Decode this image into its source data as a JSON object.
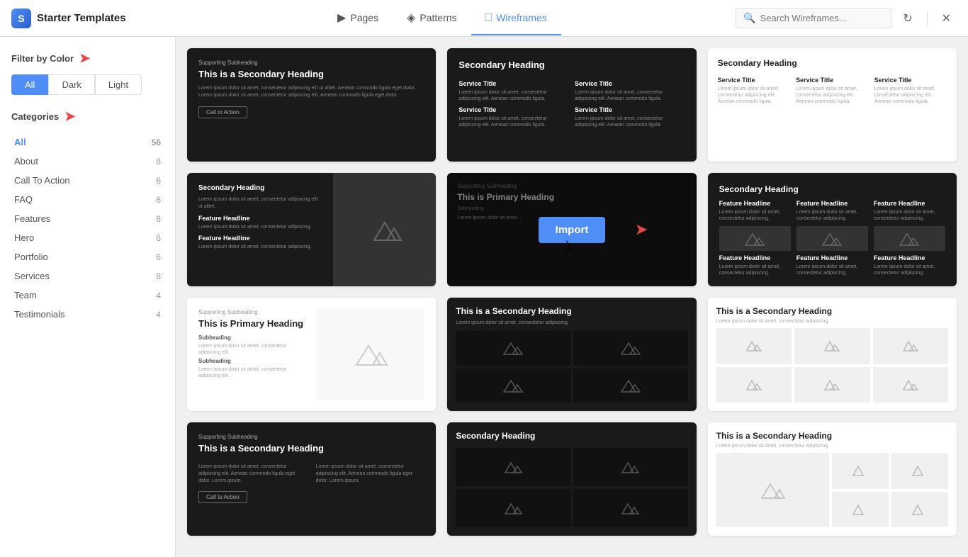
{
  "app": {
    "title": "Starter Templates",
    "logo_letter": "S"
  },
  "nav": {
    "items": [
      {
        "id": "pages",
        "label": "Pages",
        "active": false
      },
      {
        "id": "patterns",
        "label": "Patterns",
        "active": false
      },
      {
        "id": "wireframes",
        "label": "Wireframes",
        "active": true
      }
    ]
  },
  "search": {
    "placeholder": "Search Wireframes..."
  },
  "sidebar": {
    "filter_label": "Filter by Color",
    "filter_buttons": [
      {
        "id": "all",
        "label": "All",
        "active": true
      },
      {
        "id": "dark",
        "label": "Dark",
        "active": false
      },
      {
        "id": "light",
        "label": "Light",
        "active": false
      }
    ],
    "categories_label": "Categories",
    "categories": [
      {
        "label": "All",
        "count": 56,
        "active": true
      },
      {
        "label": "About",
        "count": 8
      },
      {
        "label": "Call To Action",
        "count": 6
      },
      {
        "label": "FAQ",
        "count": 6
      },
      {
        "label": "Features",
        "count": 8
      },
      {
        "label": "Hero",
        "count": 6
      },
      {
        "label": "Portfolio",
        "count": 6
      },
      {
        "label": "Services",
        "count": 8
      },
      {
        "label": "Team",
        "count": 4
      },
      {
        "label": "Testimonials",
        "count": 4
      }
    ]
  },
  "import_button_label": "Import",
  "cards": [
    {
      "id": 1,
      "type": "dark-cta",
      "heading": "This is a Secondary Heading"
    },
    {
      "id": 2,
      "type": "dark-services",
      "heading": "Secondary Heading"
    },
    {
      "id": 3,
      "type": "light-features",
      "heading": "Secondary Heading"
    },
    {
      "id": 4,
      "type": "dark-split",
      "heading": "Secondary Heading"
    },
    {
      "id": 5,
      "type": "dark-import",
      "heading": "This is Primary Heading"
    },
    {
      "id": 6,
      "type": "dark-3col-mtn",
      "heading": "Secondary Heading"
    },
    {
      "id": 7,
      "type": "light-primary",
      "heading": "This is Primary Heading"
    },
    {
      "id": 8,
      "type": "dark-grid",
      "heading": "This is a Secondary Heading"
    },
    {
      "id": 9,
      "type": "light-grid",
      "heading": "This is a Secondary Heading"
    },
    {
      "id": 10,
      "type": "dark-with-btn",
      "heading": "This is a Secondary Heading"
    },
    {
      "id": 11,
      "type": "dark-bottom-grid",
      "heading": "Secondary Heading"
    },
    {
      "id": 12,
      "type": "light-bottom",
      "heading": "This is a Secondary Heading"
    }
  ]
}
